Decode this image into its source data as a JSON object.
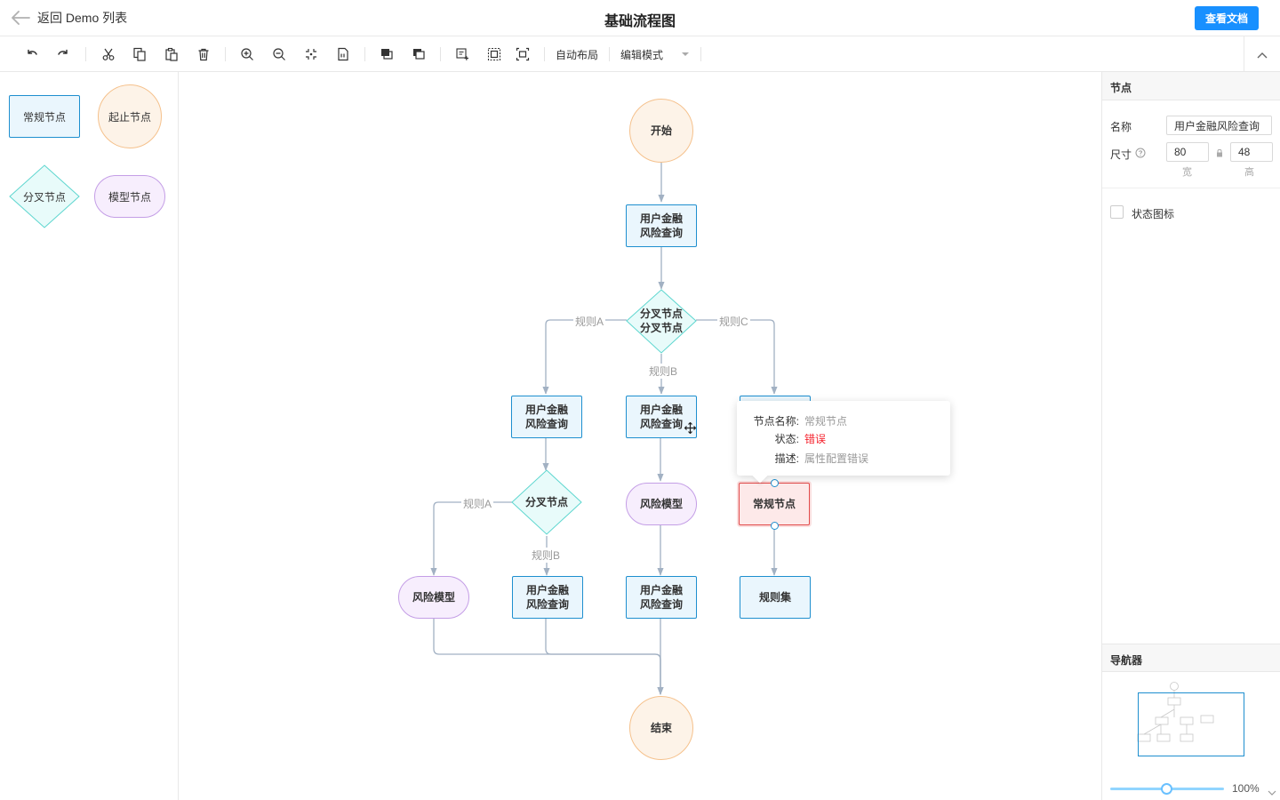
{
  "header": {
    "back_label": "返回 Demo 列表",
    "title": "基础流程图",
    "doc_button": "查看文档"
  },
  "toolbar": {
    "buttons": [
      "undo-icon",
      "redo-icon",
      "cut-icon",
      "copy-icon",
      "paste-icon",
      "delete-icon",
      "zoom-in-icon",
      "zoom-out-icon",
      "fit-view-icon",
      "actual-size-icon",
      "bring-front-icon",
      "send-back-icon",
      "group-icon",
      "select-all-icon",
      "clear-selection-icon"
    ],
    "auto_layout": "自动布局",
    "mode_select": "编辑模式"
  },
  "stencil": {
    "regular": "常规节点",
    "start_end": "起止节点",
    "branch": "分叉节点",
    "model": "模型节点"
  },
  "graph": {
    "start": "开始",
    "query1_l1": "用户金融",
    "query1_l2": "风险查询",
    "branch1_l1": "分叉节点",
    "branch1_l2": "分叉节点",
    "rule_a": "规则A",
    "rule_b": "规则B",
    "rule_c": "规则C",
    "q_left_l1": "用户金融",
    "q_left_l2": "风险查询",
    "q_mid_l1": "用户金融",
    "q_mid_l2": "风险查询",
    "branch2": "分叉节点",
    "rule_a2": "规则A",
    "rule_b2": "规则B",
    "model_mid": "风险模型",
    "regular_error": "常规节点",
    "model_left": "风险模型",
    "q_b1_l1": "用户金融",
    "q_b1_l2": "风险查询",
    "q_b2_l1": "用户金融",
    "q_b2_l2": "风险查询",
    "ruleset": "规则集",
    "end": "结束"
  },
  "tooltip": {
    "name_key": "节点名称:",
    "name_val": "常规节点",
    "status_key": "状态:",
    "status_val": "错误",
    "desc_key": "描述:",
    "desc_val": "属性配置错误"
  },
  "config": {
    "node_section": "节点",
    "name_label": "名称",
    "name_value": "用户金融风险查询",
    "size_label": "尺寸",
    "width": "80",
    "height": "48",
    "width_caption": "宽",
    "height_caption": "高",
    "status_icon_label": "状态图标",
    "navigator": "导航器",
    "zoom": "100%",
    "zoom_fraction": 0.5
  },
  "colors": {
    "accent": "#1890ff",
    "error": "#f5222d"
  }
}
